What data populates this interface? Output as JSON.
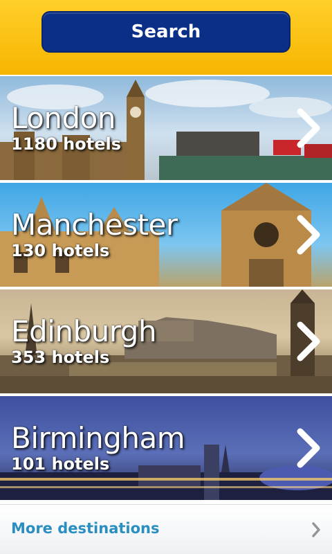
{
  "header": {
    "search_label": "Search"
  },
  "destinations": [
    {
      "name": "London",
      "hotels": "1180 hotels"
    },
    {
      "name": "Manchester",
      "hotels": "130 hotels"
    },
    {
      "name": "Edinburgh",
      "hotels": "353 hotels"
    },
    {
      "name": "Birmingham",
      "hotels": "101 hotels"
    }
  ],
  "footer": {
    "more_label": "More destinations"
  },
  "colors": {
    "accent_yellow": "#f7b500",
    "button_blue": "#0b2f86",
    "link_blue": "#2a8fc0"
  },
  "icons": {
    "row_arrow": "chevron-right-icon"
  }
}
